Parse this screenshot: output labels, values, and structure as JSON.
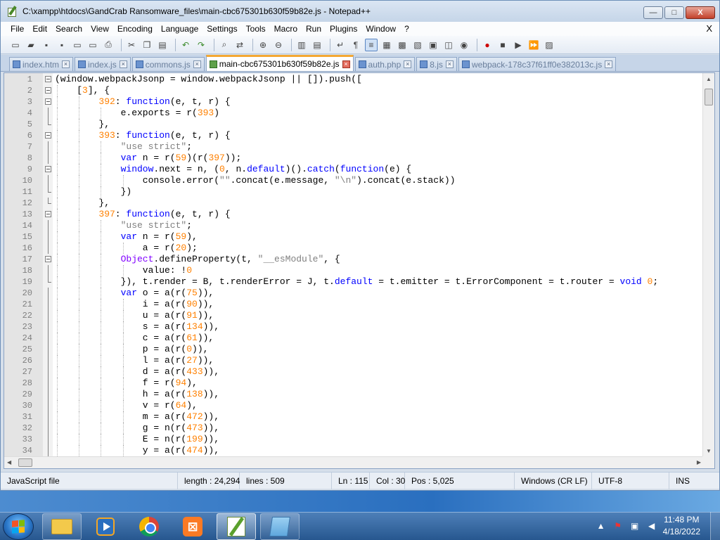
{
  "window": {
    "title": "C:\\xampp\\htdocs\\GandCrab Ransomware_files\\main-cbc675301b630f59b82e.js - Notepad++",
    "min_symbol": "—",
    "max_symbol": "□",
    "close_symbol": "X"
  },
  "menu": {
    "items": [
      "File",
      "Edit",
      "Search",
      "View",
      "Encoding",
      "Language",
      "Settings",
      "Tools",
      "Macro",
      "Run",
      "Plugins",
      "Window",
      "?"
    ],
    "close": "X"
  },
  "tabs": [
    {
      "label": "index.htm",
      "active": false
    },
    {
      "label": "index.js",
      "active": false
    },
    {
      "label": "commons.js",
      "active": false
    },
    {
      "label": "main-cbc675301b630f59b82e.js",
      "active": true
    },
    {
      "label": "auth.php",
      "active": false
    },
    {
      "label": "8.js",
      "active": false
    },
    {
      "label": "webpack-178c37f61ff0e382013c.js",
      "active": false
    }
  ],
  "editor": {
    "lines": [
      {
        "n": "1",
        "fold": "minus",
        "indent": 0,
        "code": [
          [
            "",
            "(window.webpackJsonp = window.webpackJsonp || []).push(["
          ]
        ]
      },
      {
        "n": "2",
        "fold": "minus",
        "indent": 1,
        "code": [
          [
            "",
            "["
          ],
          [
            "num",
            "3"
          ],
          [
            "",
            "], {"
          ]
        ]
      },
      {
        "n": "3",
        "fold": "minus",
        "indent": 2,
        "code": [
          [
            "num",
            "392"
          ],
          [
            "",
            ": "
          ],
          [
            "kw",
            "function"
          ],
          [
            "",
            "(e, t, r) {"
          ]
        ]
      },
      {
        "n": "4",
        "fold": "line",
        "indent": 3,
        "code": [
          [
            "",
            "e.exports = r("
          ],
          [
            "num",
            "393"
          ],
          [
            "",
            ")"
          ]
        ]
      },
      {
        "n": "5",
        "fold": "end",
        "indent": 2,
        "code": [
          [
            "",
            "},"
          ]
        ]
      },
      {
        "n": "6",
        "fold": "minus",
        "indent": 2,
        "code": [
          [
            "num",
            "393"
          ],
          [
            "",
            ": "
          ],
          [
            "kw",
            "function"
          ],
          [
            "",
            "(e, t, r) {"
          ]
        ]
      },
      {
        "n": "7",
        "fold": "line",
        "indent": 3,
        "code": [
          [
            "str",
            "\"use strict\""
          ],
          [
            "",
            ";"
          ]
        ]
      },
      {
        "n": "8",
        "fold": "line",
        "indent": 3,
        "code": [
          [
            "kw",
            "var"
          ],
          [
            "",
            " n = r("
          ],
          [
            "num",
            "59"
          ],
          [
            "",
            ")(r("
          ],
          [
            "num",
            "397"
          ],
          [
            "",
            "));"
          ]
        ]
      },
      {
        "n": "9",
        "fold": "minus",
        "indent": 3,
        "code": [
          [
            "kw",
            "window"
          ],
          [
            "",
            ".next = n, ("
          ],
          [
            "num",
            "0"
          ],
          [
            "",
            ", n."
          ],
          [
            "kw",
            "default"
          ],
          [
            "",
            ")()."
          ],
          [
            "kw",
            "catch"
          ],
          [
            "",
            "("
          ],
          [
            "kw",
            "function"
          ],
          [
            "",
            "(e) {"
          ]
        ]
      },
      {
        "n": "10",
        "fold": "line",
        "indent": 4,
        "code": [
          [
            "",
            "console.error("
          ],
          [
            "str",
            "\"\""
          ],
          [
            "",
            ".concat(e.message, "
          ],
          [
            "str",
            "\"\\n\""
          ],
          [
            "",
            ").concat(e.stack))"
          ]
        ]
      },
      {
        "n": "11",
        "fold": "end",
        "indent": 3,
        "code": [
          [
            "",
            "})"
          ]
        ]
      },
      {
        "n": "12",
        "fold": "end",
        "indent": 2,
        "code": [
          [
            "",
            "},"
          ]
        ]
      },
      {
        "n": "13",
        "fold": "minus",
        "indent": 2,
        "code": [
          [
            "num",
            "397"
          ],
          [
            "",
            ": "
          ],
          [
            "kw",
            "function"
          ],
          [
            "",
            "(e, t, r) {"
          ]
        ]
      },
      {
        "n": "14",
        "fold": "line",
        "indent": 3,
        "code": [
          [
            "str",
            "\"use strict\""
          ],
          [
            "",
            ";"
          ]
        ]
      },
      {
        "n": "15",
        "fold": "line",
        "indent": 3,
        "code": [
          [
            "kw",
            "var"
          ],
          [
            "",
            " n = r("
          ],
          [
            "num",
            "59"
          ],
          [
            "",
            "),"
          ]
        ]
      },
      {
        "n": "16",
        "fold": "line",
        "indent": 4,
        "code": [
          [
            "",
            "a = r("
          ],
          [
            "num",
            "20"
          ],
          [
            "",
            ");"
          ]
        ]
      },
      {
        "n": "17",
        "fold": "minus",
        "indent": 3,
        "code": [
          [
            "obj",
            "Object"
          ],
          [
            "",
            ".defineProperty(t, "
          ],
          [
            "str",
            "\"__esModule\""
          ],
          [
            "",
            ", {"
          ]
        ]
      },
      {
        "n": "18",
        "fold": "line",
        "indent": 4,
        "code": [
          [
            "",
            "value: !"
          ],
          [
            "num",
            "0"
          ]
        ]
      },
      {
        "n": "19",
        "fold": "end",
        "indent": 3,
        "code": [
          [
            "",
            "}), t.render = B, t.renderError = J, t."
          ],
          [
            "kw",
            "default"
          ],
          [
            "",
            " = t.emitter = t.ErrorComponent = t.router = "
          ],
          [
            "kw",
            "void"
          ],
          [
            "",
            " "
          ],
          [
            "num",
            "0"
          ],
          [
            "",
            ";"
          ]
        ]
      },
      {
        "n": "20",
        "fold": "line",
        "indent": 3,
        "code": [
          [
            "kw",
            "var"
          ],
          [
            "",
            " o = a(r("
          ],
          [
            "num",
            "75"
          ],
          [
            "",
            ")),"
          ]
        ]
      },
      {
        "n": "21",
        "fold": "line",
        "indent": 4,
        "code": [
          [
            "",
            "i = a(r("
          ],
          [
            "num",
            "90"
          ],
          [
            "",
            ")),"
          ]
        ]
      },
      {
        "n": "22",
        "fold": "line",
        "indent": 4,
        "code": [
          [
            "",
            "u = a(r("
          ],
          [
            "num",
            "91"
          ],
          [
            "",
            ")),"
          ]
        ]
      },
      {
        "n": "23",
        "fold": "line",
        "indent": 4,
        "code": [
          [
            "",
            "s = a(r("
          ],
          [
            "num",
            "134"
          ],
          [
            "",
            ")),"
          ]
        ]
      },
      {
        "n": "24",
        "fold": "line",
        "indent": 4,
        "code": [
          [
            "",
            "c = a(r("
          ],
          [
            "num",
            "61"
          ],
          [
            "",
            ")),"
          ]
        ]
      },
      {
        "n": "25",
        "fold": "line",
        "indent": 4,
        "code": [
          [
            "",
            "p = a(r("
          ],
          [
            "num",
            "0"
          ],
          [
            "",
            ")),"
          ]
        ]
      },
      {
        "n": "26",
        "fold": "line",
        "indent": 4,
        "code": [
          [
            "",
            "l = a(r("
          ],
          [
            "num",
            "27"
          ],
          [
            "",
            ")),"
          ]
        ]
      },
      {
        "n": "27",
        "fold": "line",
        "indent": 4,
        "code": [
          [
            "",
            "d = a(r("
          ],
          [
            "num",
            "433"
          ],
          [
            "",
            ")),"
          ]
        ]
      },
      {
        "n": "28",
        "fold": "line",
        "indent": 4,
        "code": [
          [
            "",
            "f = r("
          ],
          [
            "num",
            "94"
          ],
          [
            "",
            "),"
          ]
        ]
      },
      {
        "n": "29",
        "fold": "line",
        "indent": 4,
        "code": [
          [
            "",
            "h = a(r("
          ],
          [
            "num",
            "138"
          ],
          [
            "",
            ")),"
          ]
        ]
      },
      {
        "n": "30",
        "fold": "line",
        "indent": 4,
        "code": [
          [
            "",
            "v = r("
          ],
          [
            "num",
            "64"
          ],
          [
            "",
            "),"
          ]
        ]
      },
      {
        "n": "31",
        "fold": "line",
        "indent": 4,
        "code": [
          [
            "",
            "m = a(r("
          ],
          [
            "num",
            "472"
          ],
          [
            "",
            ")),"
          ]
        ]
      },
      {
        "n": "32",
        "fold": "line",
        "indent": 4,
        "code": [
          [
            "",
            "g = n(r("
          ],
          [
            "num",
            "473"
          ],
          [
            "",
            ")),"
          ]
        ]
      },
      {
        "n": "33",
        "fold": "line",
        "indent": 4,
        "code": [
          [
            "",
            "E = n(r("
          ],
          [
            "num",
            "199"
          ],
          [
            "",
            ")),"
          ]
        ]
      },
      {
        "n": "34",
        "fold": "line",
        "indent": 4,
        "code": [
          [
            "",
            "y = a(r("
          ],
          [
            "num",
            "474"
          ],
          [
            "",
            ")),"
          ]
        ]
      }
    ]
  },
  "statusbar": {
    "file_type": "JavaScript file",
    "length": "length : 24,294",
    "lines": "lines : 509",
    "ln": "Ln : 115",
    "col": "Col : 30",
    "pos": "Pos : 5,025",
    "eol": "Windows (CR LF)",
    "encoding": "UTF-8",
    "mode": "INS"
  },
  "taskbar": {
    "time": "11:48 PM",
    "date": "4/18/2022"
  },
  "colors": {
    "keyword": "#0000ff",
    "number": "#ff8000",
    "string": "#808080",
    "object": "#8000ff",
    "active_tab_accent": "#f4a833"
  }
}
